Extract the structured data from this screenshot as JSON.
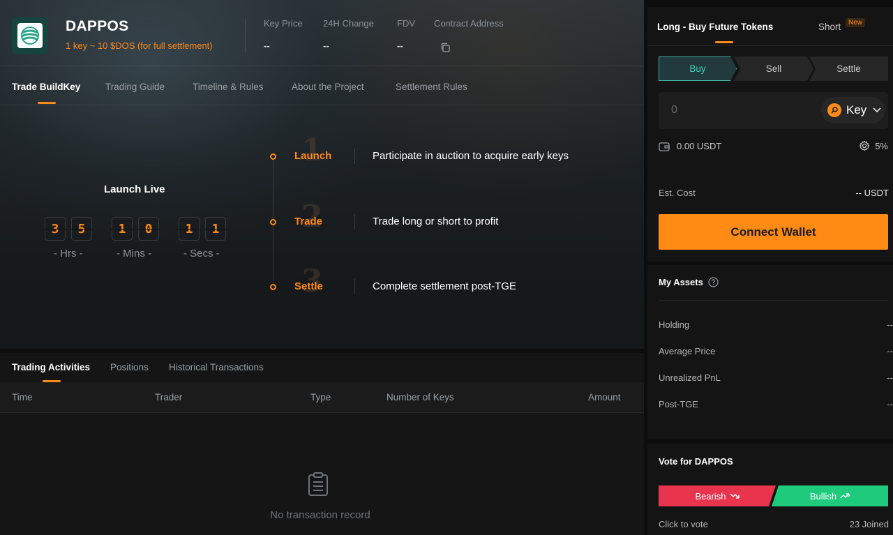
{
  "project": {
    "name": "DAPPOS",
    "subtitle": "1 key ~ 10 $DOS (for full settlement)",
    "stats": [
      {
        "label": "Key Price",
        "value": "--"
      },
      {
        "label": "24H Change",
        "value": "--"
      },
      {
        "label": "FDV",
        "value": "--"
      },
      {
        "label": "Contract Address",
        "value": ""
      }
    ]
  },
  "tabs": [
    "Trade BuildKey",
    "Trading Guide",
    "Timeline & Rules",
    "About the Project",
    "Settlement Rules"
  ],
  "countdown": {
    "title": "Launch Live",
    "digits": [
      "3",
      "5",
      "1",
      "0",
      "1",
      "1"
    ],
    "labels": [
      "- Hrs -",
      "- Mins -",
      "- Secs -"
    ]
  },
  "timeline": [
    {
      "title": "Launch",
      "desc": "Participate in auction to acquire early keys"
    },
    {
      "title": "Trade",
      "desc": "Trade long or short to profit"
    },
    {
      "title": "Settle",
      "desc": "Complete settlement post-TGE"
    }
  ],
  "activity": {
    "tabs": [
      "Trading Activities",
      "Positions",
      "Historical Transactions"
    ],
    "columns": [
      "Time",
      "Trader",
      "Type",
      "Number of Keys",
      "Amount"
    ],
    "empty_text": "No transaction record"
  },
  "trade_panel": {
    "tab_long": "Long - Buy Future Tokens",
    "tab_short": "Short",
    "new_badge": "New",
    "segments": [
      "Buy",
      "Sell",
      "Settle"
    ],
    "amount_value": "0",
    "token": "Key",
    "balance": "0.00 USDT",
    "slippage": "5%",
    "est_cost_label": "Est. Cost",
    "est_cost_value": "-- USDT",
    "connect_label": "Connect Wallet"
  },
  "assets": {
    "title": "My Assets",
    "rows": [
      {
        "label": "Holding",
        "value": "--"
      },
      {
        "label": "Average Price",
        "value": "--"
      },
      {
        "label": "Unrealized PnL",
        "value": "--"
      },
      {
        "label": "Post-TGE",
        "value": "--"
      }
    ]
  },
  "vote": {
    "title": "Vote for DAPPOS",
    "bearish": "Bearish",
    "bullish": "Bullish",
    "click_text": "Click to vote",
    "joined": "23 Joined"
  },
  "colors": {
    "accent": "#ff8a1a",
    "bearish": "#e8344d",
    "bullish": "#1ecb7c",
    "buy": "#3fd1bd"
  }
}
